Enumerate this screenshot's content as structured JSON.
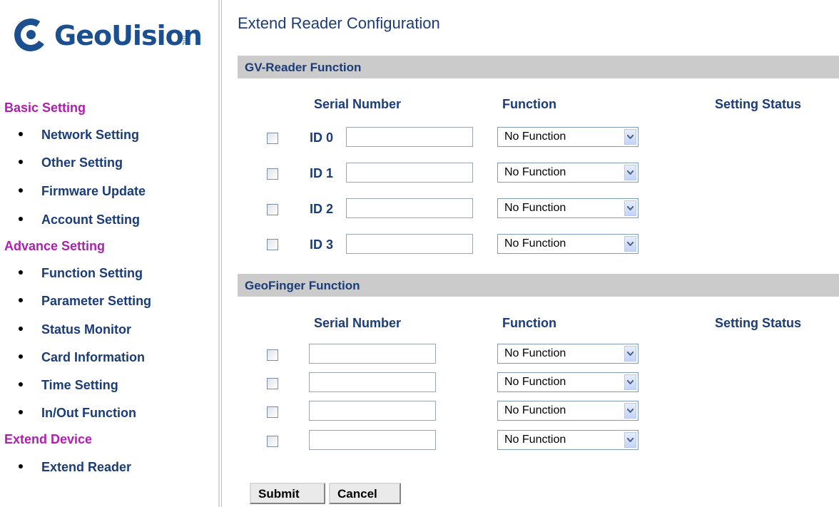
{
  "logo": {
    "text": "GeoUision",
    "inc": "inc"
  },
  "sidebar": {
    "basic_setting": "Basic Setting",
    "basic_items": [
      "Network Setting",
      "Other Setting",
      "Firmware Update",
      "Account Setting"
    ],
    "advance_setting": "Advance Setting",
    "advance_items": [
      "Function Setting",
      "Parameter Setting",
      "Status Monitor",
      "Card Information",
      "Time Setting",
      "In/Out Function"
    ],
    "extend_device": "Extend Device",
    "extend_items": [
      "Extend Reader"
    ]
  },
  "main": {
    "title": "Extend Reader Configuration",
    "gv_reader": {
      "section_title": "GV-Reader Function",
      "col_serial": "Serial Number",
      "col_function": "Function",
      "col_status": "Setting Status",
      "rows": [
        {
          "id": "ID 0",
          "serial": "",
          "function": "No Function"
        },
        {
          "id": "ID 1",
          "serial": "",
          "function": "No Function"
        },
        {
          "id": "ID 2",
          "serial": "",
          "function": "No Function"
        },
        {
          "id": "ID 3",
          "serial": "",
          "function": "No Function"
        }
      ]
    },
    "geofinger": {
      "section_title": "GeoFinger Function",
      "col_serial": "Serial Number",
      "col_function": "Function",
      "col_status": "Setting Status",
      "rows": [
        {
          "serial": "",
          "function": "No Function"
        },
        {
          "serial": "",
          "function": "No Function"
        },
        {
          "serial": "",
          "function": "No Function"
        },
        {
          "serial": "",
          "function": "No Function"
        }
      ]
    },
    "submit_label": "Submit",
    "cancel_label": "Cancel"
  }
}
